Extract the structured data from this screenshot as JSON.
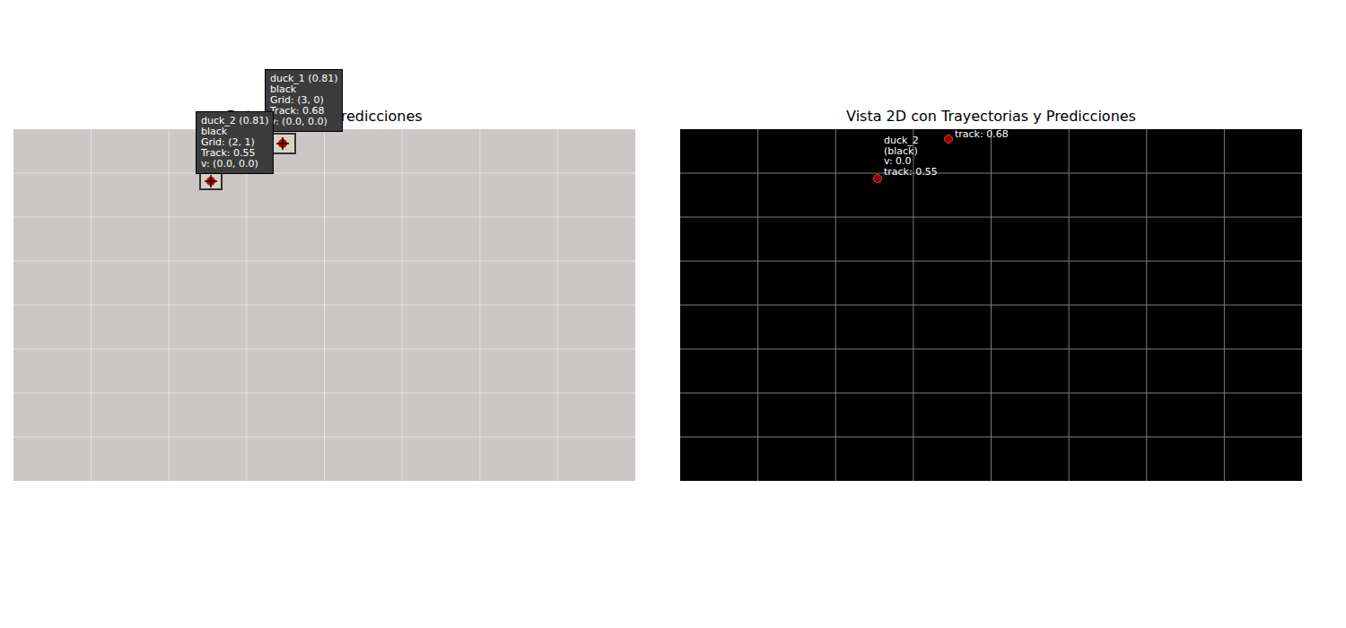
{
  "figure": {
    "left_panel": {
      "title": "Detecciones y Predicciones",
      "detections": [
        {
          "lines": [
            "duck_1 (0.81)",
            "black",
            "Grid: (3, 0)",
            "Track: 0.68",
            "v: (0.0, 0.0)"
          ]
        },
        {
          "lines": [
            "duck_2 (0.81)",
            "black",
            "Grid: (2, 1)",
            "Track: 0.55",
            "v: (0.0, 0.0)"
          ]
        }
      ]
    },
    "right_panel": {
      "title": "Vista 2D con Trayectorias y Predicciones",
      "points": [
        {
          "lines": [
            "track: 0.68"
          ],
          "color": "#8b0000"
        },
        {
          "lines": [
            "duck_2",
            "(black)",
            "v: 0.0",
            "track: 0.55"
          ],
          "color": "#8b0000"
        }
      ]
    }
  }
}
